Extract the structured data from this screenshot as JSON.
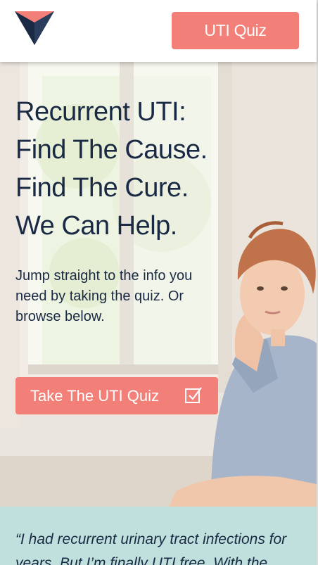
{
  "header": {
    "logo": "triangle-logo",
    "quiz_button": "UTI Quiz"
  },
  "hero": {
    "headline": [
      "Recurrent UTI:",
      "Find The Cause.",
      "Find The Cure.",
      "We Can Help."
    ],
    "subtext": "Jump straight to the info you need by taking the quiz. Or browse below.",
    "cta_label": "Take The UTI Quiz",
    "cta_icon": "checkbox-icon"
  },
  "testimonial": {
    "quote": "“I had recurrent urinary tract infections for years. But I’m finally UTI free. With the"
  },
  "colors": {
    "navy": "#1b2a44",
    "coral": "#f27f78",
    "mint": "#bfe0dc"
  }
}
